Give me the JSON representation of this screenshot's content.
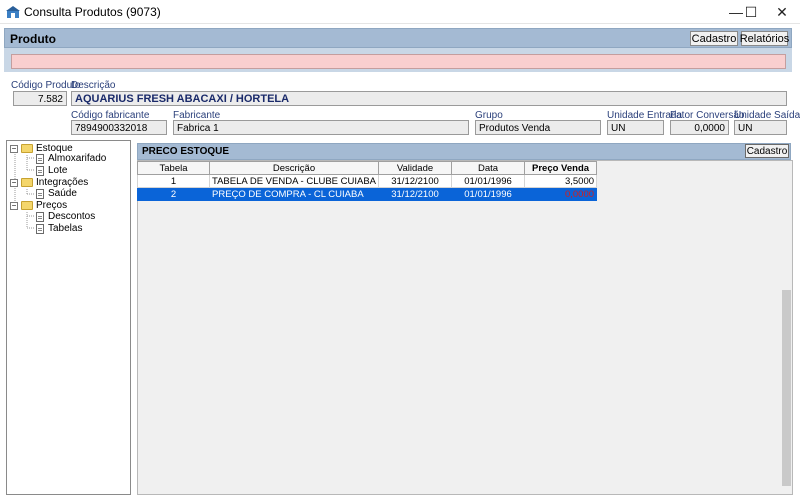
{
  "window": {
    "title": "Consulta Produtos (9073)",
    "controls": {
      "minimize": "—",
      "maximize": "☐",
      "close": "✕"
    }
  },
  "header": {
    "title": "Produto",
    "buttons": {
      "cadastro": "Cadastro",
      "relatorios": "Relatórios"
    }
  },
  "search": {
    "value": ""
  },
  "fields": {
    "codigo_produto": {
      "label": "Código Produto",
      "value": "7.582"
    },
    "descricao": {
      "label": "Descrição",
      "value": "AQUARIUS FRESH ABACAXI / HORTELA"
    },
    "codigo_fabricante": {
      "label": "Código fabricante",
      "value": "7894900332018"
    },
    "fabricante": {
      "label": "Fabricante",
      "value": "Fabrica 1"
    },
    "grupo": {
      "label": "Grupo",
      "value": "Produtos Venda"
    },
    "unidade_entrada": {
      "label": "Unidade Entrada",
      "value": "UN"
    },
    "fator_conversao": {
      "label": "Fator Conversão",
      "value": "0,0000"
    },
    "unidade_saida": {
      "label": "Unidade Saída",
      "value": "UN"
    }
  },
  "tree": [
    {
      "label": "Estoque",
      "type": "folder",
      "expander": "−"
    },
    {
      "label": "Almoxarifado",
      "type": "doc"
    },
    {
      "label": "Lote",
      "type": "doc"
    },
    {
      "label": "Integrações",
      "type": "folder",
      "expander": "−"
    },
    {
      "label": "Saúde",
      "type": "doc"
    },
    {
      "label": "Preços",
      "type": "folder",
      "expander": "−"
    },
    {
      "label": "Descontos",
      "type": "doc"
    },
    {
      "label": "Tabelas",
      "type": "doc"
    }
  ],
  "panel": {
    "title": "PRECO ESTOQUE",
    "cadastro_button": "Cadastro",
    "columns": [
      "Tabela",
      "Descrição",
      "Validade",
      "Data",
      "Preço Venda"
    ],
    "rows": [
      {
        "tabela": "1",
        "descricao": "TABELA DE VENDA - CLUBE CUIABA",
        "validade": "31/12/2100",
        "data": "01/01/1996",
        "preco": "3,5000",
        "selected": false
      },
      {
        "tabela": "2",
        "descricao": "PREÇO DE COMPRA - CL CUIABA",
        "validade": "31/12/2100",
        "data": "01/01/1996",
        "preco": "0,0000",
        "selected": true
      }
    ]
  },
  "colors": {
    "band": "#a4bad3",
    "search_bg": "#f9cfcf",
    "selection": "#0a64d8",
    "label": "#2a3f7a"
  }
}
